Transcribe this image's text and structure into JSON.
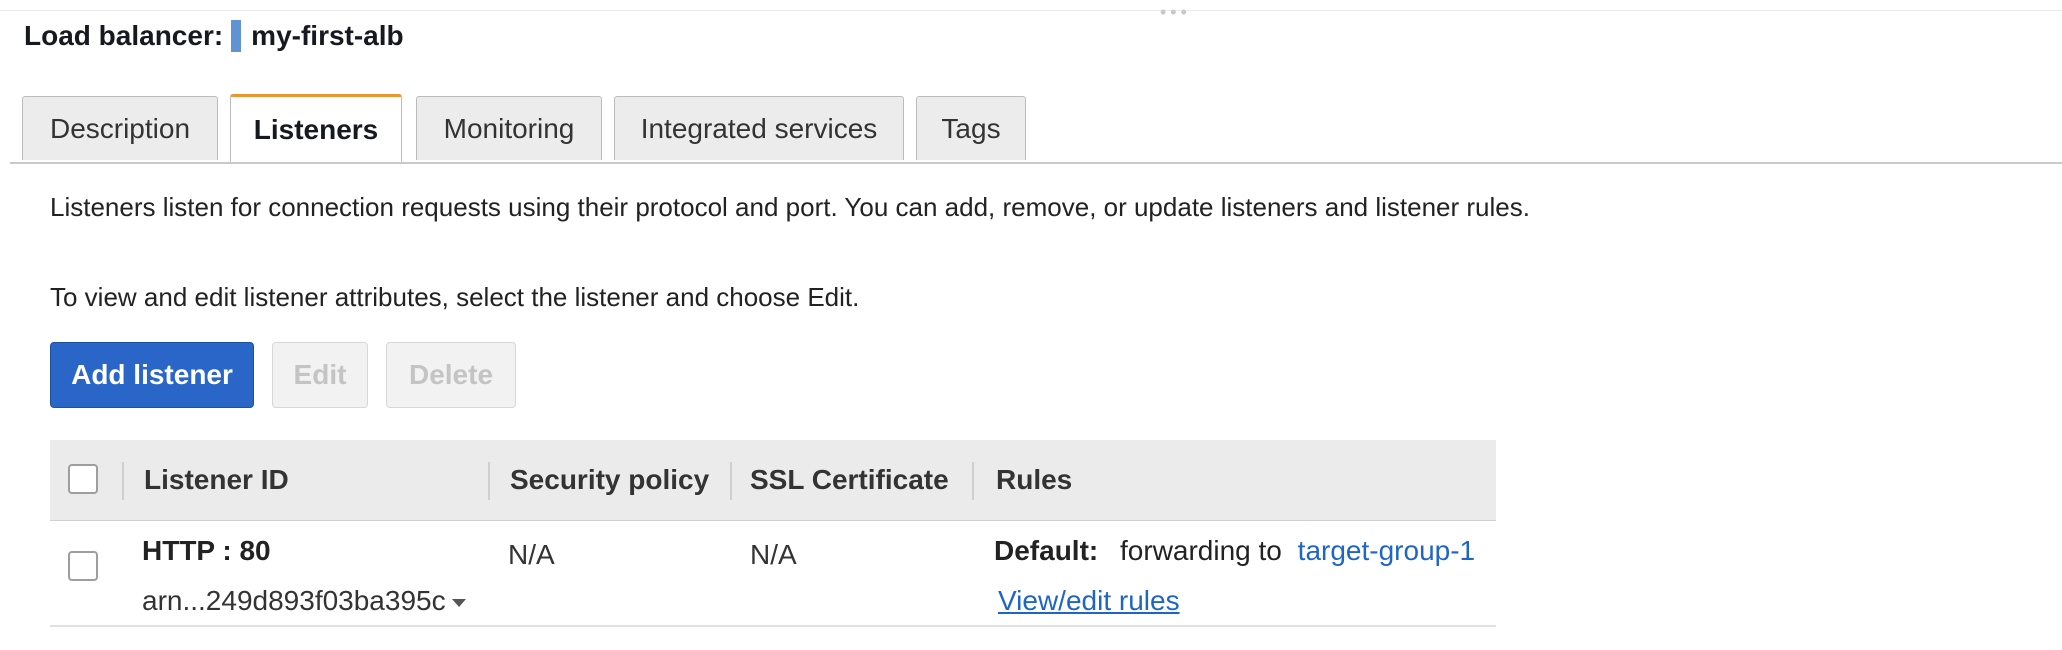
{
  "header": {
    "label": "Load balancer:",
    "name": "my-first-alb"
  },
  "tabs": [
    {
      "label": "Description",
      "active": false
    },
    {
      "label": "Listeners",
      "active": true
    },
    {
      "label": "Monitoring",
      "active": false
    },
    {
      "label": "Integrated services",
      "active": false
    },
    {
      "label": "Tags",
      "active": false
    }
  ],
  "content": {
    "intro": "Listeners listen for connection requests using their protocol and port. You can add, remove, or update listeners and listener rules.",
    "hint": "To view and edit listener attributes, select the listener and choose Edit."
  },
  "actions": {
    "add_label": "Add listener",
    "edit_label": "Edit",
    "delete_label": "Delete"
  },
  "table": {
    "columns": [
      "Listener ID",
      "Security policy",
      "SSL Certificate",
      "Rules"
    ],
    "rows": [
      {
        "listener": "HTTP : 80",
        "arn": "arn...249d893f03ba395c",
        "security_policy": "N/A",
        "ssl_certificate": "N/A",
        "rules_default_label": "Default:",
        "rules_action": "forwarding to",
        "rules_target": "target-group-1",
        "rules_link": "View/edit rules"
      }
    ]
  },
  "colors": {
    "accent": "#ec9630",
    "primary_button": "#2a66c7",
    "link": "#1f66c4",
    "title_marker": "#5f93d3"
  }
}
